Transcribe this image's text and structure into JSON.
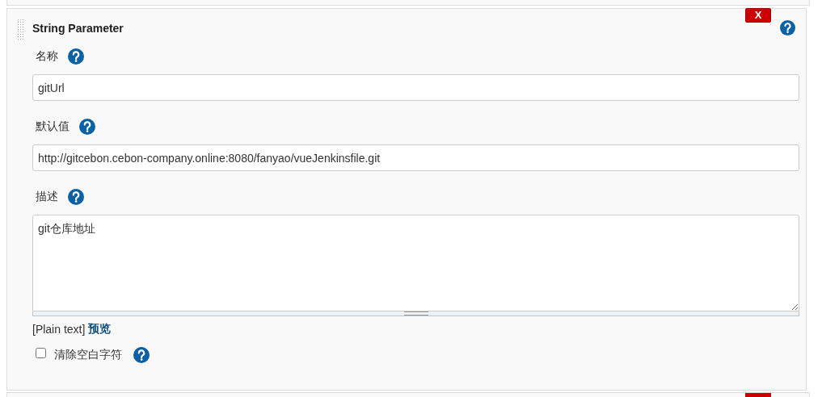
{
  "header": {
    "title": "String Parameter",
    "delete_button": "X"
  },
  "fields": [
    {
      "kind": "input",
      "label": "名称",
      "value": "gitUrl"
    },
    {
      "kind": "input",
      "label": "默认值",
      "value": "http://gitcebon.cebon-company.online:8080/fanyao/vueJenkinsfile.git"
    },
    {
      "kind": "textarea",
      "label": "描述",
      "value": "git仓库地址"
    }
  ],
  "format": {
    "syntax": "[Plain text]",
    "preview_link": "预览"
  },
  "trim": {
    "label": "清除空白字符",
    "checked": false
  }
}
